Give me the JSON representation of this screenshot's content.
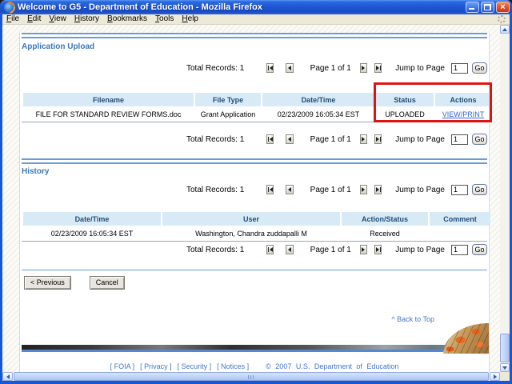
{
  "window": {
    "title": "Welcome to G5 - Department of Education - Mozilla Firefox"
  },
  "menu": {
    "items": [
      "File",
      "Edit",
      "View",
      "History",
      "Bookmarks",
      "Tools",
      "Help"
    ]
  },
  "sections": {
    "upload": "Application Upload",
    "history": "History"
  },
  "pagination": {
    "total": "Total Records: 1",
    "page": "Page 1 of 1",
    "jump": "Jump to Page",
    "jump_value": "1",
    "go": "Go"
  },
  "upload_table": {
    "headers": [
      "Filename",
      "File Type",
      "Date/Time",
      "Status",
      "Actions"
    ],
    "row": {
      "filename": "FILE FOR STANDARD REVIEW FORMS.doc",
      "file_type": "Grant Application",
      "datetime": "02/23/2009 16:05:34 EST",
      "status": "UPLOADED",
      "action": "VIEW/PRINT"
    }
  },
  "history_table": {
    "headers": [
      "Date/Time",
      "User",
      "Action/Status",
      "Comment"
    ],
    "row": {
      "datetime": "02/23/2009 16:05:34 EST",
      "user": "Washington, Chandra zuddapalli M",
      "action_status": "Received",
      "comment": ""
    }
  },
  "buttons": {
    "previous": "< Previous",
    "cancel": "Cancel"
  },
  "footer": {
    "back_to_top": "^ Back to Top",
    "links": [
      "[ FOIA ]",
      "[ Privacy ]",
      "[ Security ]",
      "[ Notices ]"
    ],
    "copyright": "© 2007 U.S. Department of Education"
  },
  "colors": {
    "annotation_red": "#e01313",
    "table_header_bg": "#d9eaf7",
    "table_header_text": "#1f4e79",
    "link_blue": "#3366cc",
    "heading_blue": "#3b78b5"
  }
}
